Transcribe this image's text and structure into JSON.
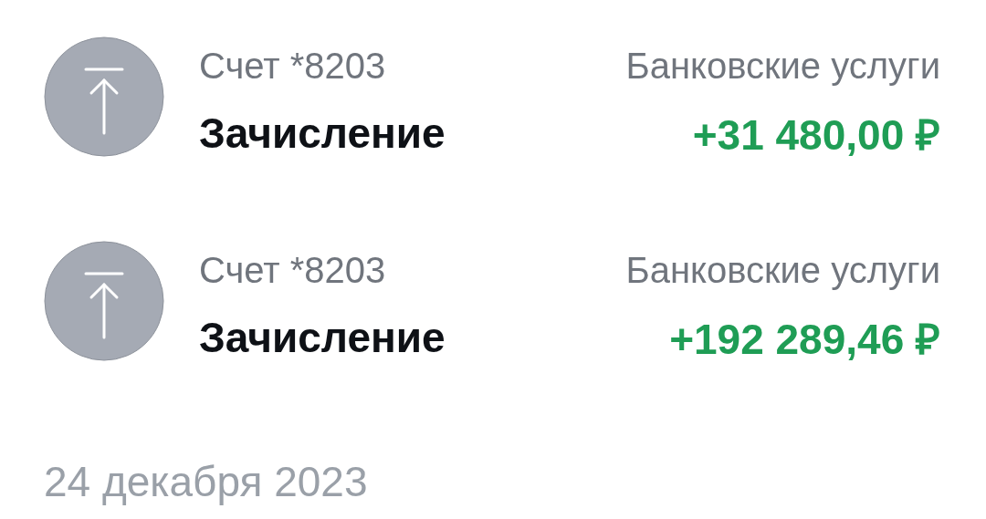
{
  "transactions": [
    {
      "account": "Счет *8203",
      "title": "Зачисление",
      "category": "Банковские услуги",
      "amount": "+31 480,00 ₽"
    },
    {
      "account": "Счет *8203",
      "title": "Зачисление",
      "category": "Банковские услуги",
      "amount": "+192 289,46 ₽"
    }
  ],
  "date_header": "24 декабря 2023"
}
